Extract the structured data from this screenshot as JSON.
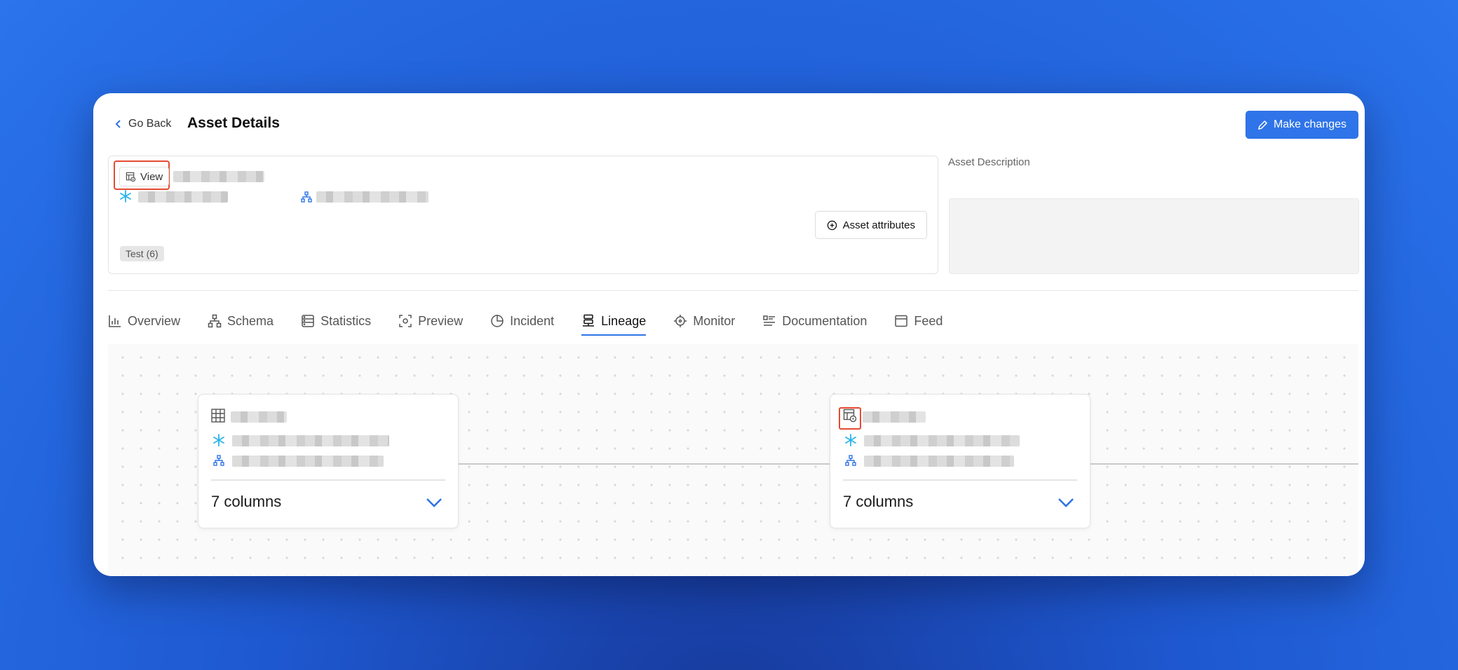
{
  "header": {
    "go_back_label": "Go Back",
    "title": "Asset Details",
    "make_changes_label": "Make changes"
  },
  "asset": {
    "type_label": "View",
    "asset_attributes_label": "Asset attributes",
    "tag_label": "Test (6)",
    "description_label": "Asset Description"
  },
  "tabs": [
    {
      "label": "Overview",
      "icon": "bar-chart-icon"
    },
    {
      "label": "Schema",
      "icon": "hierarchy-icon"
    },
    {
      "label": "Statistics",
      "icon": "table-stats-icon"
    },
    {
      "label": "Preview",
      "icon": "preview-icon"
    },
    {
      "label": "Incident",
      "icon": "clock-incident-icon"
    },
    {
      "label": "Lineage",
      "icon": "lineage-icon",
      "active": true
    },
    {
      "label": "Monitor",
      "icon": "target-icon"
    },
    {
      "label": "Documentation",
      "icon": "doc-list-icon"
    },
    {
      "label": "Feed",
      "icon": "window-icon"
    }
  ],
  "lineage": {
    "upstream_node": {
      "columns_label": "7 columns",
      "icon": "table-grid-icon"
    },
    "current_node": {
      "columns_label": "7 columns",
      "icon": "view-icon"
    }
  },
  "colors": {
    "accent": "#2f74e8",
    "highlight_outline": "#e44b32",
    "snowflake": "#29b5e8"
  }
}
